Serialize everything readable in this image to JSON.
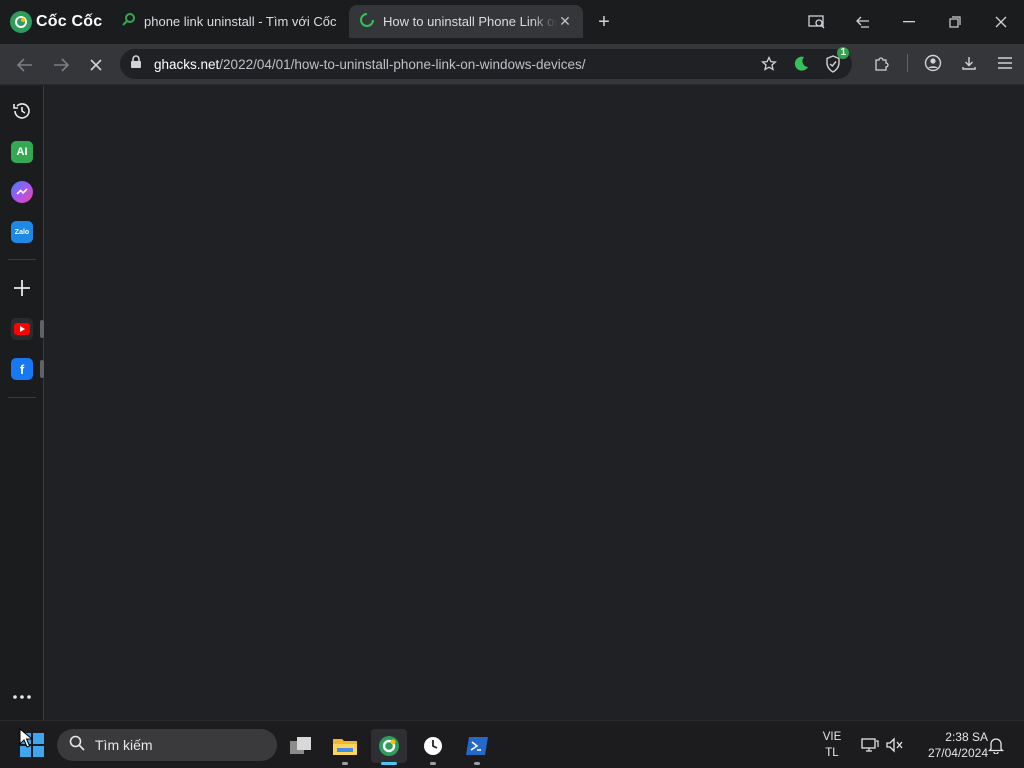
{
  "brand": {
    "name": "Cốc Cốc"
  },
  "tabs": [
    {
      "title": "phone link uninstall - Tìm với Cốc Cốc",
      "active": false
    },
    {
      "title": "How to uninstall Phone Link on Windows devices",
      "active": true
    }
  ],
  "toolbar": {
    "url_host": "ghacks.net",
    "url_path": "/2022/04/01/how-to-uninstall-phone-link-on-windows-devices/",
    "shield_badge": "1"
  },
  "sidebar": {
    "items": [
      {
        "name": "history-icon",
        "label": ""
      },
      {
        "name": "ai-icon",
        "label": "AI"
      },
      {
        "name": "messenger-icon",
        "label": ""
      },
      {
        "name": "zalo-icon",
        "label": "Zalo"
      },
      {
        "name": "add-icon",
        "label": ""
      },
      {
        "name": "youtube-icon",
        "label": ""
      },
      {
        "name": "facebook-icon",
        "label": "f"
      }
    ]
  },
  "taskbar": {
    "search_placeholder": "Tìm kiếm",
    "language": {
      "line1": "VIE",
      "line2": "TL"
    },
    "clock": {
      "time": "2:38 SA",
      "date": "27/04/2024"
    }
  },
  "colors": {
    "accent": "#2c9d5a",
    "tab_active": "#35363a",
    "content_bg": "#202124",
    "taskbar_active": "#4fc3f7"
  }
}
